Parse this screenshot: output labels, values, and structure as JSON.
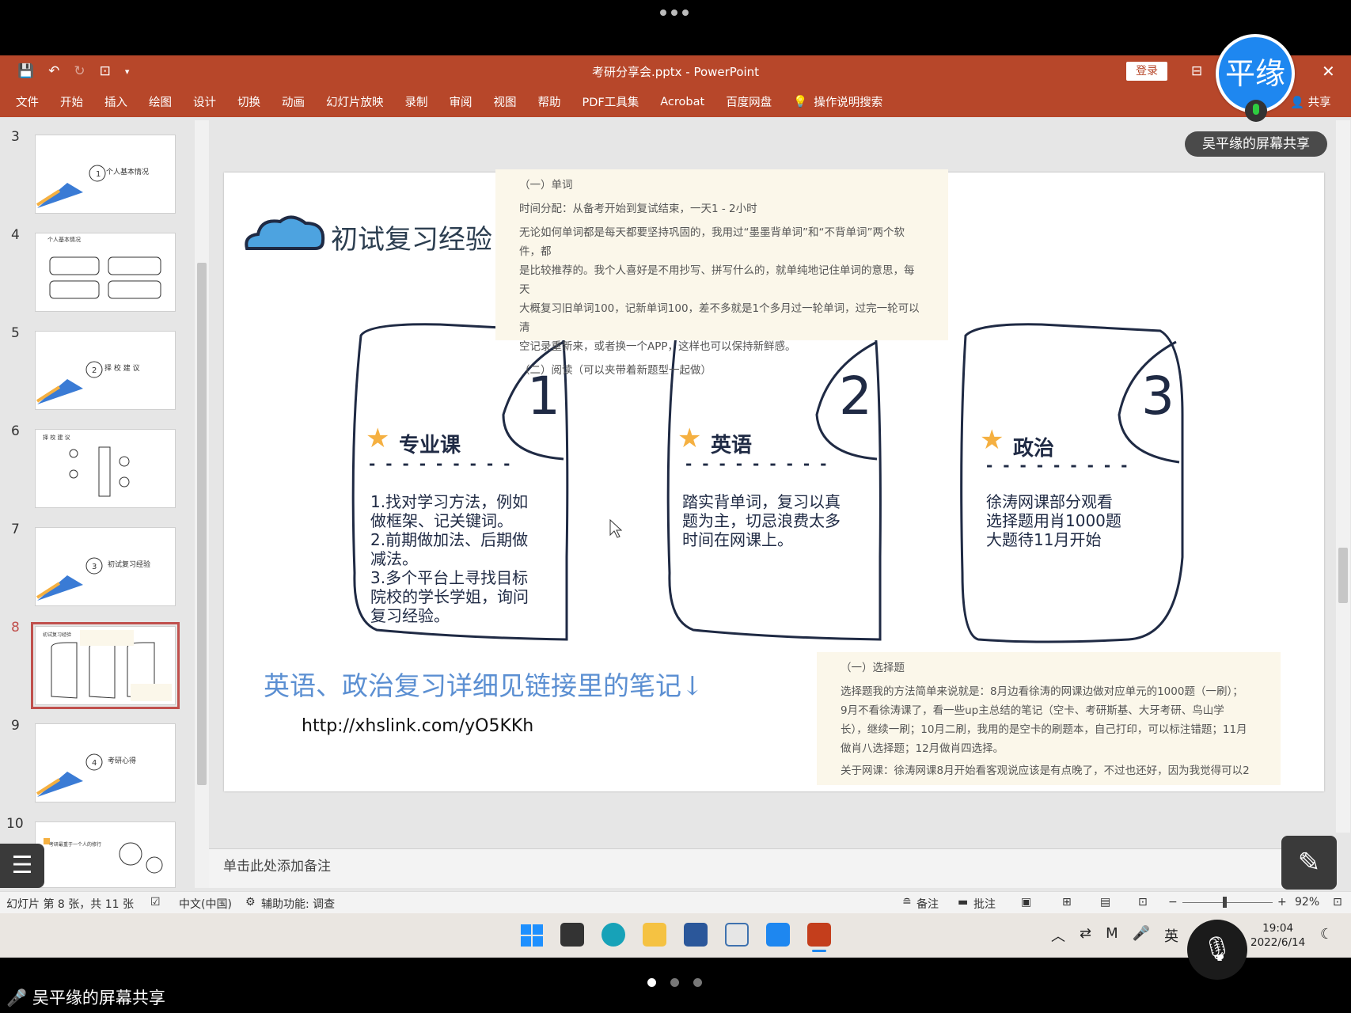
{
  "window": {
    "title": "考研分享会.pptx  -  PowerPoint",
    "login": "登录",
    "share": "共享"
  },
  "ribbon": {
    "tabs": [
      "文件",
      "开始",
      "插入",
      "绘图",
      "设计",
      "切换",
      "动画",
      "幻灯片放映",
      "录制",
      "审阅",
      "视图",
      "帮助",
      "PDF工具集",
      "Acrobat",
      "百度网盘",
      "操作说明搜索"
    ]
  },
  "meeting": {
    "avatar_text": "平缘",
    "share_tag": "吴平缘的屏幕共享",
    "bottom_share": "吴平缘的屏幕共享"
  },
  "thumbnails": [
    {
      "num": "3",
      "label": "个人基本情况"
    },
    {
      "num": "4",
      "label": "个人基本情况"
    },
    {
      "num": "5",
      "label": "择 校 建 议"
    },
    {
      "num": "6",
      "label": "择 校 建 议"
    },
    {
      "num": "7",
      "label": "初试复习经验"
    },
    {
      "num": "8",
      "label": "初试复习经验"
    },
    {
      "num": "9",
      "label": "考研心得"
    },
    {
      "num": "10",
      "label": "考研最重于一个人的修行"
    }
  ],
  "slide": {
    "title": "初试复习经验",
    "cards": [
      {
        "num": "1",
        "title": "专业课",
        "body": [
          "1.找对学习方法，例如",
          "做框架、记关键词。",
          "2.前期做加法、后期做",
          "减法。",
          "3.多个平台上寻找目标",
          "院校的学长学姐，询问",
          "复习经验。"
        ]
      },
      {
        "num": "2",
        "title": "英语",
        "body": [
          "踏实背单词，复习以真",
          "题为主，切忌浪费太多",
          "时间在网课上。"
        ]
      },
      {
        "num": "3",
        "title": "政治",
        "body": [
          "徐涛网课部分观看",
          "选择题用肖1000题",
          "大题待11月开始"
        ]
      }
    ],
    "bottom_text": "英语、政治复习详细见链接里的笔记↓",
    "link": "http://xhslink.com/yO5KKh",
    "overlay_top": [
      "（一）单词",
      "时间分配：从备考开始到复试结束，一天1 - 2小时",
      "无论如何单词都是每天都要坚持巩固的，我用过“墨墨背单词”和“不背单词”两个软件，都",
      "是比较推荐的。我个人喜好是不用抄写、拼写什么的，就单纯地记住单词的意思，每天",
      "大概复习旧单词100，记新单词100，差不多就是1个多月过一轮单词，过完一轮可以清",
      "空记录重新来，或者换一个APP，这样也可以保持新鲜感。",
      "（二）阅读（可以夹带着新题型一起做）"
    ],
    "overlay_bottom": [
      "（一）选择题",
      "选择题我的方法简单来说就是：8月边看徐涛的网课边做对应单元的1000题（一刷）；",
      "9月不看徐涛课了，看一些up主总结的笔记（空卡、考研斯基、大牙考研、鸟山学",
      "长），继续一刷；10月二刷，我用的是空卡的刷题本，自己打印，可以标注错题；11月",
      "做肖八选择题；12月做肖四选择。",
      "关于网课：徐涛网课8月开始看客观说应该是有点晚了，不过也还好，因为我觉得可以2"
    ]
  },
  "notes": {
    "placeholder": "单击此处添加备注"
  },
  "status": {
    "slide_info": "幻灯片 第 8 张，共 11 张",
    "language": "中文(中国)",
    "accessibility": "辅助功能: 调查",
    "notes_btn": "备注",
    "comments_btn": "批注",
    "zoom": "92%"
  },
  "taskbar": {
    "ime": "英",
    "time": "19:04",
    "date": "2022/6/14"
  },
  "colors": {
    "ppt_red": "#b7472a",
    "avatar_blue": "#1e87f0",
    "link_blue": "#5b8fd2"
  }
}
